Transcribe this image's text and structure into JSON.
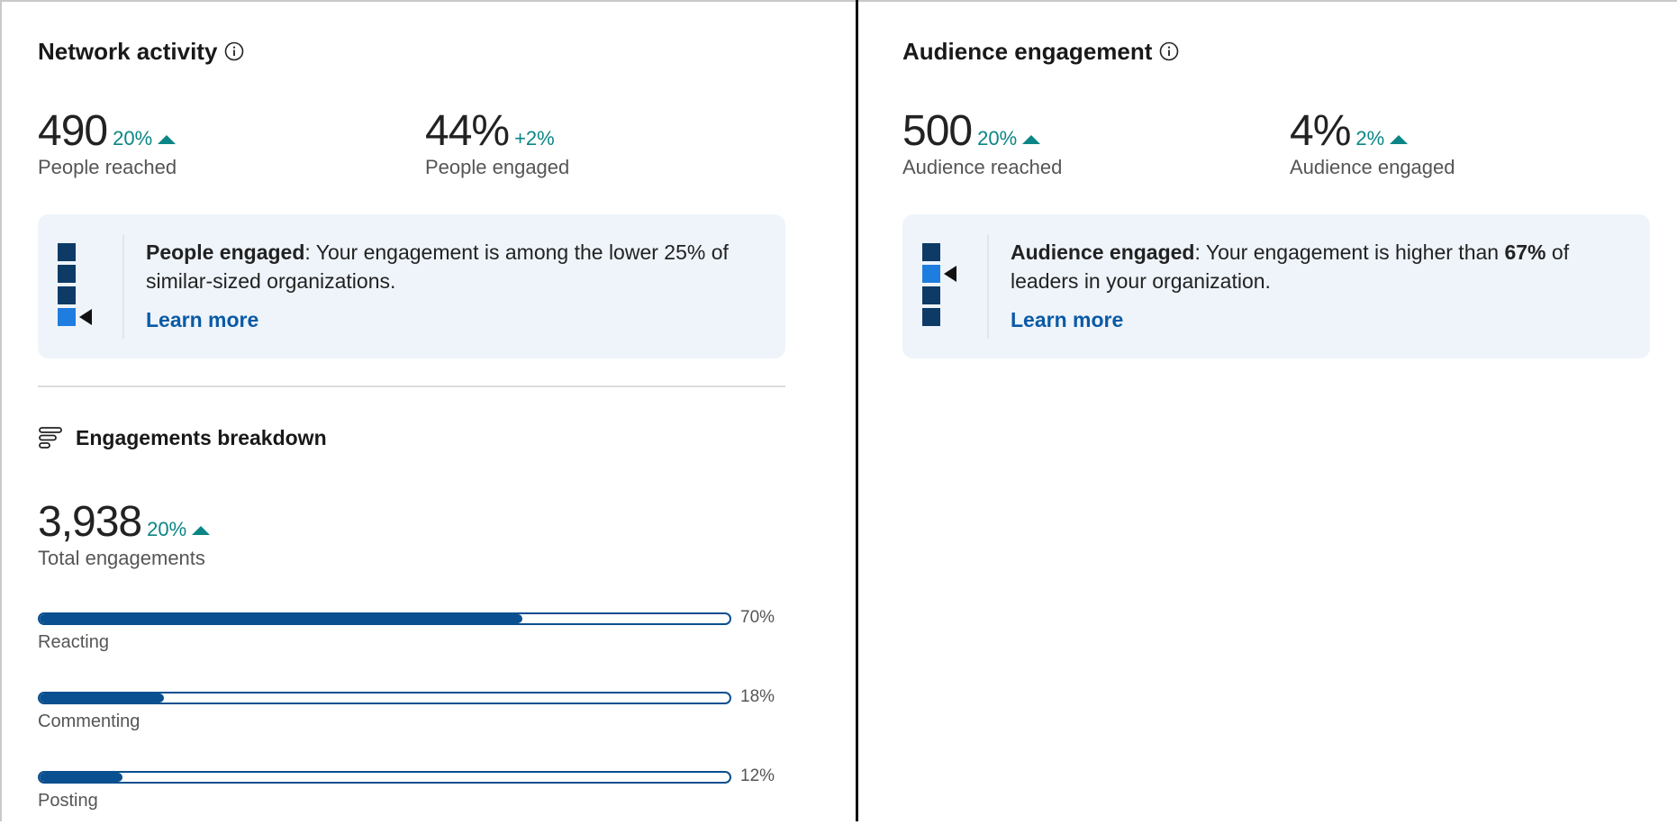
{
  "network": {
    "title": "Network activity",
    "reached": {
      "value": "490",
      "delta": "20%",
      "label": "People reached"
    },
    "engaged": {
      "value": "44%",
      "delta": "+2%",
      "label": "People engaged"
    },
    "insight": {
      "bold": "People engaged",
      "text": ": Your engagement is among the lower 25% of similar-sized organizations.",
      "learn_more": "Learn more",
      "highlight_index": 3
    },
    "breakdown": {
      "title": "Engagements breakdown",
      "total_value": "3,938",
      "total_delta": "20%",
      "total_label": "Total engagements",
      "items": [
        {
          "label": "Reacting",
          "pct_text": "70%",
          "fraction": 0.7
        },
        {
          "label": "Commenting",
          "pct_text": "18%",
          "fraction": 0.18
        },
        {
          "label": "Posting",
          "pct_text": "12%",
          "fraction": 0.12
        }
      ]
    }
  },
  "audience": {
    "title": "Audience engagement",
    "reached": {
      "value": "500",
      "delta": "20%",
      "label": "Audience reached"
    },
    "engaged": {
      "value": "4%",
      "delta": "2%",
      "label": "Audience engaged"
    },
    "insight": {
      "bold": "Audience engaged",
      "text_before": ": Your engagement is higher than ",
      "bold2": "67%",
      "text_after": " of leaders in your organization.",
      "learn_more": "Learn more",
      "highlight_index": 1
    }
  },
  "colors": {
    "accent": "#0b8585",
    "link": "#0a5aa6",
    "bar": "#0a4f8f",
    "dark_square": "#0d3b66",
    "light_square": "#1f7de0"
  }
}
